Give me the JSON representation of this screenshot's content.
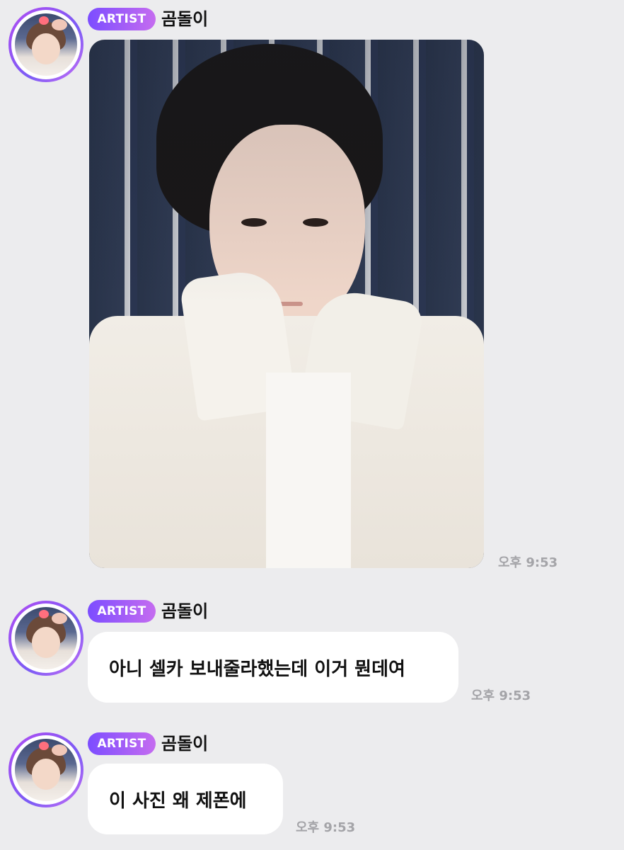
{
  "messages": [
    {
      "badge": "ARTIST",
      "sender": "곰돌이",
      "type": "image",
      "time": "오후 9:53"
    },
    {
      "badge": "ARTIST",
      "sender": "곰돌이",
      "type": "text",
      "text": "아니 셀카 보내줄라했는데 이거 뭔데여",
      "time": "오후 9:53"
    },
    {
      "badge": "ARTIST",
      "sender": "곰돌이",
      "type": "text",
      "text": "이 사진 왜 제폰에",
      "time": "오후 9:53"
    }
  ],
  "colors": {
    "background": "#ececee",
    "badge_gradient_start": "#7c4dff",
    "badge_gradient_end": "#c56cf0",
    "bubble": "#ffffff",
    "time_text": "#a4a4a8"
  }
}
